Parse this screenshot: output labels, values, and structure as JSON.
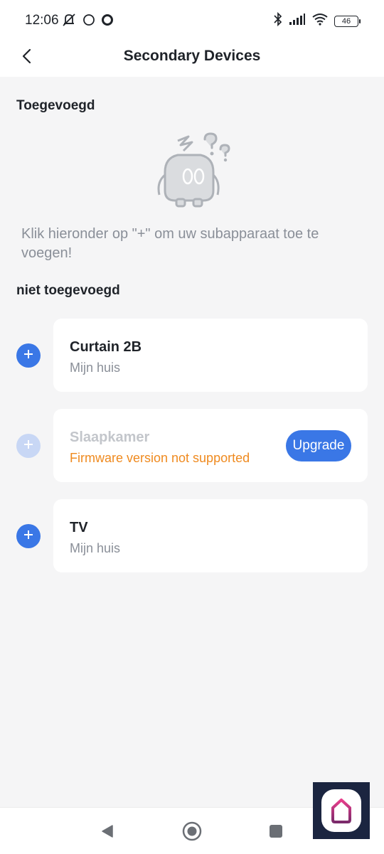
{
  "status_bar": {
    "time": "12:06",
    "battery": "46",
    "icons": [
      "mute-icon",
      "circle-icon",
      "ring-icon",
      "bluetooth-icon",
      "signal-icon",
      "wifi-icon",
      "battery-icon"
    ]
  },
  "header": {
    "title": "Secondary Devices",
    "back_icon": "chevron-left-icon"
  },
  "added_section": {
    "title": "Toegevoegd",
    "empty_illustration": "confused-robot-illustration",
    "empty_message": "Klik hieronder op \"+\" om uw subapparaat toe te voegen!"
  },
  "not_added_section": {
    "title": "niet toegevoegd",
    "devices": [
      {
        "name": "Curtain 2B",
        "location": "Mijn huis",
        "enabled": true
      },
      {
        "name": "Slaapkamer",
        "status": "Firmware version not supported",
        "action": "Upgrade",
        "enabled": false
      },
      {
        "name": "TV",
        "location": "Mijn huis",
        "enabled": true
      }
    ]
  },
  "nav_bar": {
    "buttons": [
      "back-triangle-icon",
      "home-circle-icon",
      "recents-square-icon"
    ]
  },
  "colors": {
    "accent": "#3a77e6",
    "accent_disabled": "#c8d7f5",
    "warning": "#ef8a1f",
    "muted_text": "#8a8f98",
    "background": "#f5f5f6",
    "card": "#ffffff"
  }
}
